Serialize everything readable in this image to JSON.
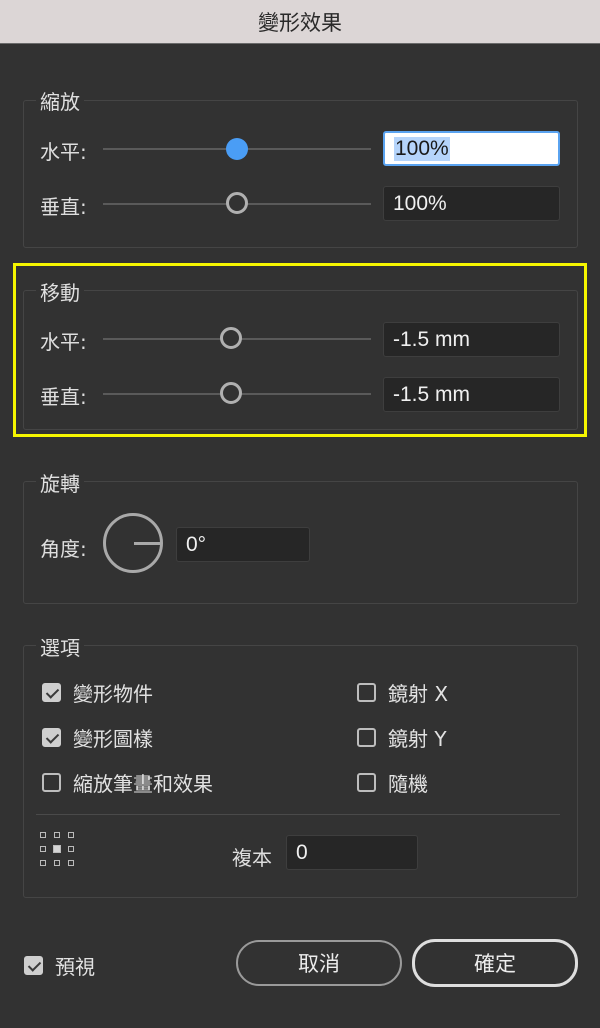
{
  "window": {
    "title": "變形效果"
  },
  "scale": {
    "label": "縮放",
    "horizontal": {
      "label": "水平:",
      "value": "100%",
      "slider_level": 0.5
    },
    "vertical": {
      "label": "垂直:",
      "value": "100%",
      "slider_level": 0.5
    }
  },
  "move": {
    "label": "移動",
    "horizontal": {
      "label": "水平:",
      "value": "-1.5 mm",
      "slider_level": 0.48
    },
    "vertical": {
      "label": "垂直:",
      "value": "-1.5 mm",
      "slider_level": 0.48
    }
  },
  "rotate": {
    "label": "旋轉",
    "angle_label": "角度:",
    "angle_value": "0°"
  },
  "options": {
    "label": "選項",
    "transform_objects": {
      "label": "變形物件",
      "checked": true
    },
    "transform_patterns": {
      "label": "變形圖樣",
      "checked": true
    },
    "scale_strokes": {
      "label": "縮放筆畫和效果",
      "checked": false
    },
    "reflect_x": {
      "label": "鏡射 X",
      "checked": false
    },
    "reflect_y": {
      "label": "鏡射 Y",
      "checked": false
    },
    "random": {
      "label": "隨機",
      "checked": false
    },
    "copies_label": "複本",
    "copies_value": "0"
  },
  "footer": {
    "preview": {
      "label": "預視",
      "checked": true
    },
    "cancel_label": "取消",
    "ok_label": "確定"
  },
  "colors": {
    "highlight": "#f6f600",
    "accent": "#4a9df5"
  }
}
